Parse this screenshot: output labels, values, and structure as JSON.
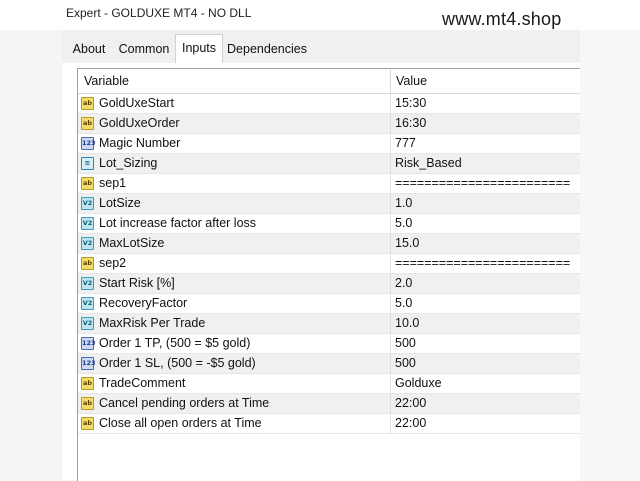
{
  "window": {
    "title": "Expert - GOLDUXE MT4 - NO DLL",
    "watermark": "www.mt4.shop"
  },
  "tabs": [
    {
      "label": "About",
      "active": false
    },
    {
      "label": "Common",
      "active": false
    },
    {
      "label": "Inputs",
      "active": true
    },
    {
      "label": "Dependencies",
      "active": false
    }
  ],
  "grid": {
    "columns": {
      "variable": "Variable",
      "value": "Value"
    },
    "rows": [
      {
        "icon": "ab-string-icon",
        "type": "ab",
        "name": "GoldUxeStart",
        "value": "15:30"
      },
      {
        "icon": "ab-string-icon",
        "type": "ab",
        "name": "GoldUxeOrder",
        "value": "16:30"
      },
      {
        "icon": "integer-icon",
        "type": "n123",
        "name": "Magic Number",
        "value": "777"
      },
      {
        "icon": "enum-icon",
        "type": "list",
        "name": "Lot_Sizing",
        "value": "Risk_Based"
      },
      {
        "icon": "ab-string-icon",
        "type": "ab",
        "name": "sep1",
        "value": "========================"
      },
      {
        "icon": "double-icon",
        "type": "v2",
        "name": "LotSize",
        "value": "1.0"
      },
      {
        "icon": "double-icon",
        "type": "v2",
        "name": "Lot increase factor after loss",
        "value": "5.0"
      },
      {
        "icon": "double-icon",
        "type": "v2",
        "name": "MaxLotSize",
        "value": "15.0"
      },
      {
        "icon": "ab-string-icon",
        "type": "ab",
        "name": "sep2",
        "value": "========================"
      },
      {
        "icon": "double-icon",
        "type": "v2",
        "name": "Start Risk [%]",
        "value": "2.0"
      },
      {
        "icon": "double-icon",
        "type": "v2",
        "name": "RecoveryFactor",
        "value": "5.0"
      },
      {
        "icon": "double-icon",
        "type": "v2",
        "name": "MaxRisk Per Trade",
        "value": "10.0"
      },
      {
        "icon": "integer-icon",
        "type": "n123",
        "name": "Order 1 TP, (500 = $5 gold)",
        "value": "500"
      },
      {
        "icon": "integer-icon",
        "type": "n123",
        "name": "Order 1 SL, (500 = -$5 gold)",
        "value": "500"
      },
      {
        "icon": "ab-string-icon",
        "type": "ab",
        "name": "TradeComment",
        "value": "Golduxe"
      },
      {
        "icon": "ab-string-icon",
        "type": "ab",
        "name": "Cancel pending orders at Time",
        "value": "22:00"
      },
      {
        "icon": "ab-string-icon",
        "type": "ab",
        "name": "Close all open orders at Time",
        "value": "22:00"
      }
    ]
  },
  "icon_glyphs": {
    "ab": "ab",
    "v2": "V2",
    "n123": "123",
    "list": "≡"
  }
}
